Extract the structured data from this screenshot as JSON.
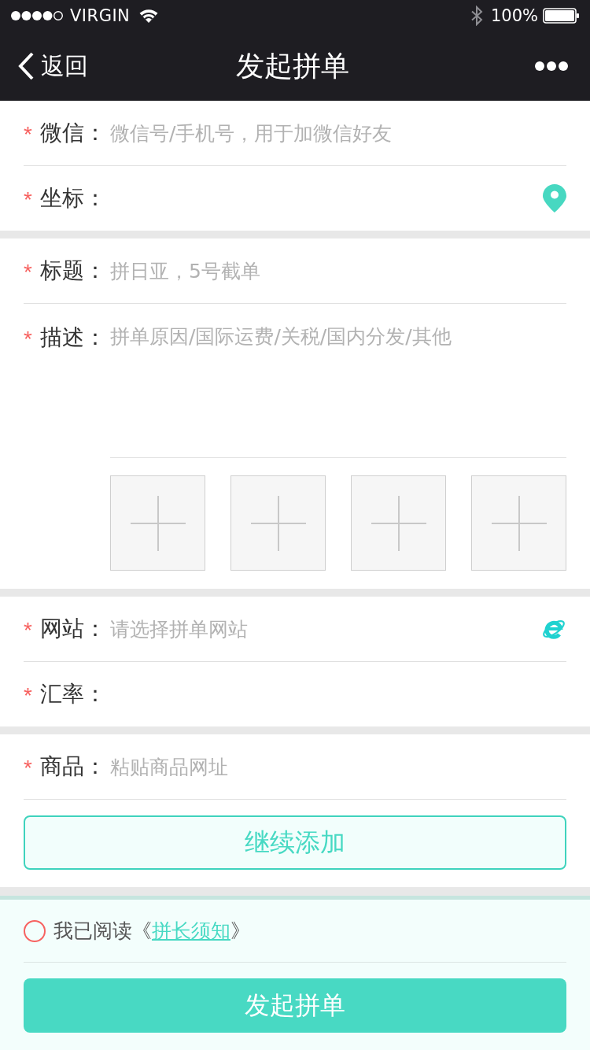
{
  "status_bar": {
    "carrier": "VIRGIN",
    "battery": "100%"
  },
  "nav": {
    "back": "返回",
    "title": "发起拼单"
  },
  "sections": [
    {
      "fields": [
        {
          "kind": "text",
          "required_mark": "*",
          "label": "微信：",
          "placeholder": "微信号/手机号，用于加微信好友"
        },
        {
          "kind": "location",
          "required_mark": "*",
          "label": "坐标："
        }
      ]
    },
    {
      "fields": [
        {
          "kind": "text",
          "required_mark": "*",
          "label": "标题：",
          "placeholder": "拼日亚，5号截单"
        },
        {
          "kind": "textarea",
          "required_mark": "*",
          "label": "描述：",
          "placeholder": "拼单原因/国际运费/关税/国内分发/其他",
          "upload_tiles": [
            {
              "kind": "add"
            },
            {
              "kind": "add"
            },
            {
              "kind": "add"
            },
            {
              "kind": "add"
            }
          ]
        }
      ]
    },
    {
      "fields": [
        {
          "kind": "website",
          "required_mark": "*",
          "label": "网站：",
          "placeholder": "请选择拼单网站"
        },
        {
          "kind": "text",
          "required_mark": "*",
          "label": "汇率："
        }
      ]
    },
    {
      "fields": [
        {
          "kind": "text",
          "required_mark": "*",
          "label": "商品：",
          "placeholder": "粘贴商品网址"
        }
      ],
      "add_button": "继续添加"
    }
  ],
  "agreement": {
    "checked": false,
    "text": "我已阅读《",
    "link": "拼长须知",
    "text_end": "》"
  },
  "submit": "发起拼单"
}
